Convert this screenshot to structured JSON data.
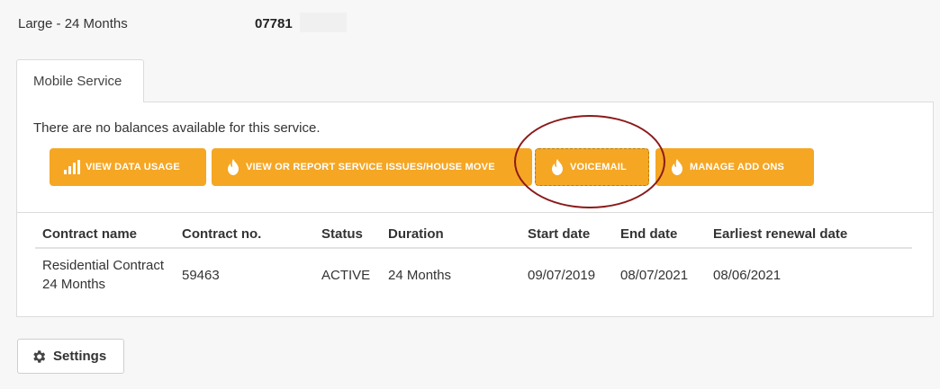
{
  "plan": {
    "name": "Large - 24 Months",
    "number": "07781"
  },
  "tab": {
    "label": "Mobile Service"
  },
  "panel": {
    "no_balance_text": "There are no balances available for this service."
  },
  "buttons": {
    "data_usage": "VIEW DATA USAGE",
    "service_issues": "VIEW OR REPORT SERVICE ISSUES/HOUSE MOVE",
    "voicemail": "VOICEMAIL",
    "add_ons": "MANAGE ADD ONS",
    "color": "#f5a623"
  },
  "contracts": {
    "headers": [
      "Contract name",
      "Contract no.",
      "Status",
      "Duration",
      "Start date",
      "End date",
      "Earliest renewal date"
    ],
    "rows": [
      [
        "Residential Contract 24 Months",
        "59463",
        "ACTIVE",
        "24 Months",
        "09/07/2019",
        "08/07/2021",
        "08/06/2021"
      ]
    ]
  },
  "settings": {
    "label": "Settings"
  },
  "annotation": {
    "color": "#8b1a1a"
  }
}
